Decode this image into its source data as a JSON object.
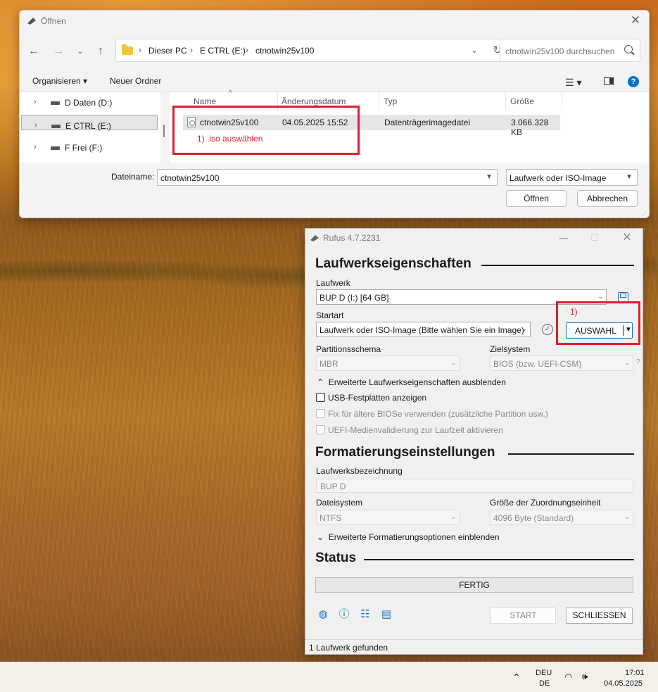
{
  "file_dialog": {
    "title": "Öffnen",
    "close": "✕",
    "breadcrumbs": [
      "Dieser PC",
      "E CTRL (E:)",
      "ctnotwin25v100"
    ],
    "search_placeholder": "ctnotwin25v100 durchsuchen",
    "toolbar": {
      "organize": "Organisieren ▾",
      "new_folder": "Neuer Ordner"
    },
    "tree": [
      {
        "label": "D Daten (D:)"
      },
      {
        "label": "E CTRL (E:)"
      },
      {
        "label": "F Frei (F:)"
      }
    ],
    "columns": {
      "name": "Name",
      "date": "Änderungsdatum",
      "type": "Typ",
      "size": "Größe"
    },
    "file": {
      "name": "ctnotwin25v100",
      "date": "04.05.2025 15:52",
      "type": "Datenträgerimagedatei",
      "size": "3.066.328 KB"
    },
    "annotation": "1) .iso auswählen",
    "filename_label": "Dateiname:",
    "filename_value": "ctnotwin25v100",
    "filetype": "Laufwerk oder ISO-Image",
    "open_btn": "Öffnen",
    "cancel_btn": "Abbrechen"
  },
  "rufus": {
    "title": "Rufus 4.7.2231",
    "drive_props_heading": "Laufwerkseigenschaften",
    "drive_label": "Laufwerk",
    "drive_value": "BUP D (I:) [64 GB]",
    "boot_label": "Startart",
    "boot_value": "Laufwerk oder ISO-Image (Bitte wählen Sie ein Image)",
    "select_btn": "AUSWAHL",
    "annotation": "1)",
    "partition_label": "Partitionsschema",
    "partition_value": "MBR",
    "target_label": "Zielsystem",
    "target_value": "BIOS (bzw. UEFI-CSM)",
    "adv_drive_toggle": "Erweiterte Laufwerkseigenschaften ausblenden",
    "chk_usb": "USB-Festplatten anzeigen",
    "chk_bios": "Fix für ältere BIOSe verwenden (zusätzliche Partition usw.)",
    "chk_uefi": "UEFI-Medienvalidierung zur Laufzeit aktivieren",
    "format_heading": "Formatierungseinstellungen",
    "volume_label": "Laufwerksbezeichnung",
    "volume_value": "BUP D",
    "fs_label": "Dateisystem",
    "fs_value": "NTFS",
    "cluster_label": "Größe der Zuordnungseinheit",
    "cluster_value": "4096 Byte (Standard)",
    "adv_format_toggle": "Erweiterte Formatierungsoptionen einblenden",
    "status_heading": "Status",
    "status_text": "FERTIG",
    "start_btn": "START",
    "close_btn": "SCHLIESSEN",
    "footer": "1 Laufwerk gefunden"
  },
  "taskbar": {
    "lang1": "DEU",
    "lang2": "DE",
    "time": "17:01",
    "date": "04.05.2025"
  },
  "colors": {
    "annotation_red": "#e01e2b",
    "accent_blue": "#1f6fb5"
  }
}
